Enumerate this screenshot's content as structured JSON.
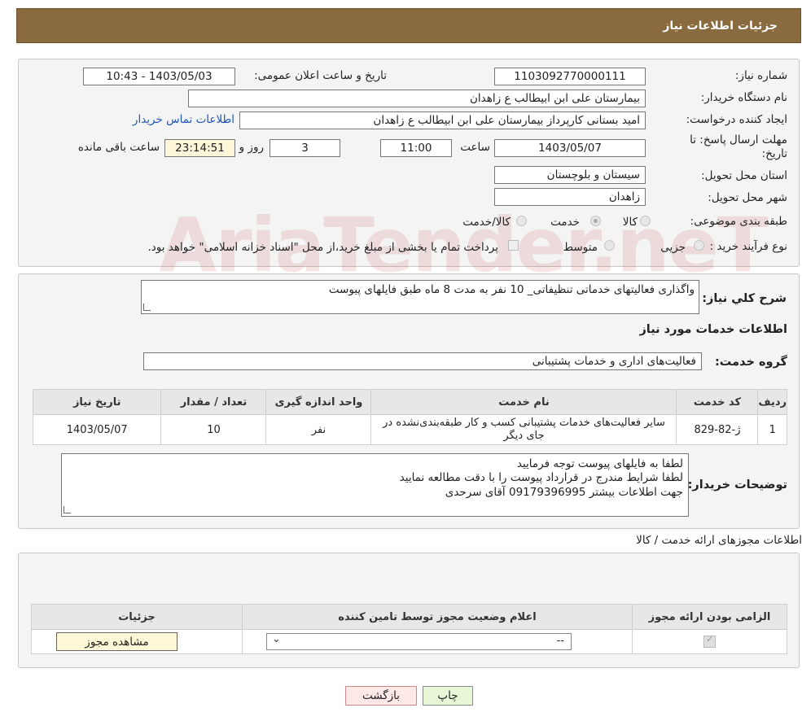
{
  "header": {
    "title": "جزئیات اطلاعات نیاز"
  },
  "form": {
    "need_number_label": "شماره نیاز:",
    "need_number": "1103092770000111",
    "announce_label": "تاریخ و ساعت اعلان عمومی:",
    "announce_value": "1403/05/03 - 10:43",
    "buyer_org_label": "نام دستگاه خریدار:",
    "buyer_org": "بیمارستان علی ابن ابیطالب  ع  زاهدان",
    "creator_label": "ایجاد کننده درخواست:",
    "creator": "امید بستانی کارپرداز  بیمارستان علی ابن ابیطالب  ع  زاهدان",
    "contact_link": "اطلاعات تماس خریدار",
    "deadline_label": "مهلت ارسال پاسخ: تا تاریخ:",
    "deadline_date": "1403/05/07",
    "time_label": "ساعت",
    "deadline_time": "11:00",
    "days_value": "3",
    "days_label": "روز و",
    "remaining_time": "23:14:51",
    "remaining_label": "ساعت باقی مانده",
    "province_label": "استان محل تحویل:",
    "province": "سیستان و بلوچستان",
    "city_label": "شهر محل تحویل:",
    "city": "زاهدان",
    "category_label": "طبقه بندی موضوعی:",
    "category_options": [
      "کالا",
      "خدمت",
      "کالا/خدمت"
    ],
    "category_selected": 1,
    "purchase_label": "نوع فرآیند خرید :",
    "purchase_options": [
      "جزیی",
      "متوسط"
    ],
    "payment_note": "پرداخت تمام یا بخشی از مبلغ خرید،از محل \"اسناد خزانه اسلامی\" خواهد بود."
  },
  "watermark": "AriaTender.neT",
  "summary": {
    "label": "شرح کلي نياز:",
    "value": "واگذاری فعالیتهای خدماتی تنظیفاتی_ 10 نفر به مدت 8 ماه طبق فایلهای پیوست",
    "services_heading": "اطلاعات خدمات مورد نياز",
    "service_group_label": "گروه خدمت:",
    "service_group": "فعالیت‌های اداری و خدمات پشتیبانی"
  },
  "services_table": {
    "headers": [
      "ردیف",
      "کد خدمت",
      "نام خدمت",
      "واحد اندازه گیری",
      "تعداد / مقدار",
      "تاریخ نیاز"
    ],
    "rows": [
      {
        "row": "1",
        "code": "ژ-82-829",
        "name": "سایر فعالیت‌های خدمات پشتیبانی کسب و کار طبقه‌بندی‌نشده در جای دیگر",
        "unit": "نفر",
        "qty": "10",
        "date": "1403/05/07"
      }
    ]
  },
  "buyer_notes": {
    "label": "توضیحات خریدار:",
    "lines": [
      "لطفا به فایلهای پیوست توجه فرمایید",
      "لطفا شرایط مندرج در قرارداد پیوست را با دقت مطالعه نمایید",
      "جهت اطلاعات بیشتر 09179396995 آقای سرحدی"
    ]
  },
  "license": {
    "heading": "اطلاعات مجوزهای ارائه خدمت / کالا",
    "headers": [
      "الزامی بودن ارائه مجوز",
      "اعلام وضعیت مجوز توسط تامین کننده",
      "جزئیات"
    ],
    "select_value": "--",
    "view_button": "مشاهده مجوز"
  },
  "buttons": {
    "print": "چاپ",
    "back": "بازگشت"
  }
}
